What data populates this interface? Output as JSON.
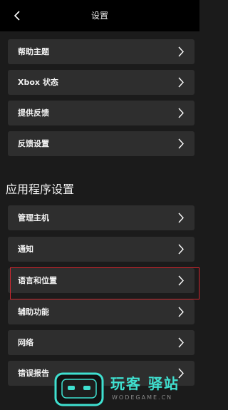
{
  "header": {
    "title": "设置"
  },
  "items": [
    {
      "label": "帮助主题"
    },
    {
      "label": "Xbox 状态"
    },
    {
      "label": "提供反馈"
    },
    {
      "label": "反馈设置"
    }
  ],
  "section": {
    "title": "应用程序设置"
  },
  "app_items": [
    {
      "label": "管理主机"
    },
    {
      "label": "通知"
    },
    {
      "label": "语言和位置"
    },
    {
      "label": "辅助功能"
    },
    {
      "label": "网络"
    },
    {
      "label": "错误报告"
    }
  ],
  "watermark": {
    "cn": "玩客 驿站",
    "en": "WODEGAME.CN"
  },
  "colors": {
    "accent_highlight": "#d0272f",
    "watermark": "#3fe0d0"
  }
}
